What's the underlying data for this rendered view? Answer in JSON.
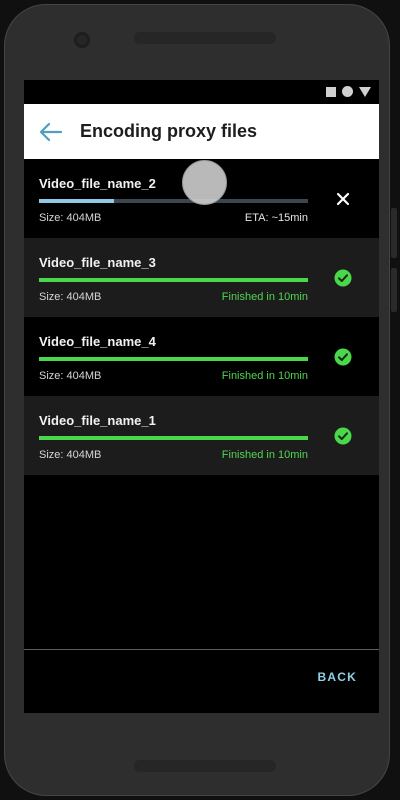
{
  "app_bar": {
    "title": "Encoding proxy files",
    "back_icon": "arrow-left-icon"
  },
  "status_bar": {
    "icons": [
      "square-icon",
      "circle-icon",
      "triangle-icon"
    ]
  },
  "files": [
    {
      "name": "Video_file_name_2",
      "size": "Size: 404MB",
      "status": "ETA: ~15min",
      "progress": 0.28,
      "state": "encoding",
      "action_icon": "close-icon"
    },
    {
      "name": "Video_file_name_3",
      "size": "Size: 404MB",
      "status": "Finished in 10min",
      "progress": 1.0,
      "state": "finished",
      "action_icon": "check-circle-icon"
    },
    {
      "name": "Video_file_name_4",
      "size": "Size: 404MB",
      "status": "Finished in 10min",
      "progress": 1.0,
      "state": "finished",
      "action_icon": "check-circle-icon"
    },
    {
      "name": "Video_file_name_1",
      "size": "Size: 404MB",
      "status": "Finished in 10min",
      "progress": 1.0,
      "state": "finished",
      "action_icon": "check-circle-icon"
    }
  ],
  "footer": {
    "back_label": "BACK"
  },
  "colors": {
    "accent_blue": "#8fd0e8",
    "progress_blue": "#8fc9e4",
    "progress_track": "#3b4650",
    "success_green": "#4bd74b",
    "status_green": "#52d452"
  }
}
